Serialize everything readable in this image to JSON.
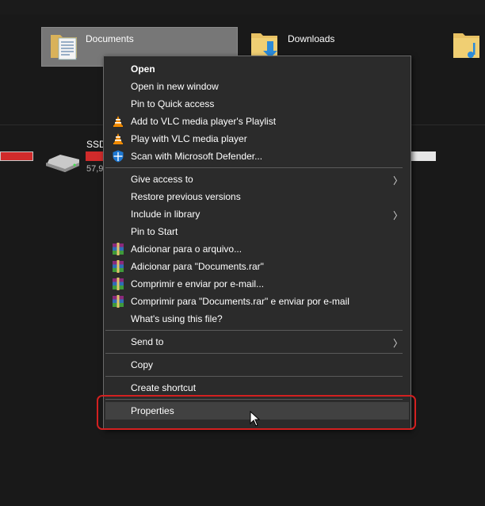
{
  "folders": {
    "documents_label": "Documents",
    "downloads_label": "Downloads"
  },
  "drive": {
    "label": "SSD",
    "size": "57,9"
  },
  "context_menu": {
    "items": [
      {
        "label": "Open",
        "bold": true,
        "icon": "",
        "submenu": false
      },
      {
        "label": "Open in new window",
        "icon": "",
        "submenu": false
      },
      {
        "label": "Pin to Quick access",
        "icon": "",
        "submenu": false
      },
      {
        "label": "Add to VLC media player's Playlist",
        "icon": "vlc-icon",
        "submenu": false
      },
      {
        "label": "Play with VLC media player",
        "icon": "vlc-icon",
        "submenu": false
      },
      {
        "label": "Scan with Microsoft Defender...",
        "icon": "defender-icon",
        "submenu": false
      },
      {
        "label": "Give access to",
        "icon": "",
        "submenu": true
      },
      {
        "label": "Restore previous versions",
        "icon": "",
        "submenu": false
      },
      {
        "label": "Include in library",
        "icon": "",
        "submenu": true
      },
      {
        "label": "Pin to Start",
        "icon": "",
        "submenu": false
      },
      {
        "label": "Adicionar para o arquivo...",
        "icon": "winrar-icon",
        "submenu": false
      },
      {
        "label": "Adicionar para \"Documents.rar\"",
        "icon": "winrar-icon",
        "submenu": false
      },
      {
        "label": "Comprimir e enviar por e-mail...",
        "icon": "winrar-icon",
        "submenu": false
      },
      {
        "label": "Comprimir para \"Documents.rar\" e enviar por e-mail",
        "icon": "winrar-icon",
        "submenu": false
      },
      {
        "label": "What's using this file?",
        "icon": "",
        "submenu": false
      },
      {
        "label": "Send to",
        "icon": "",
        "submenu": true
      },
      {
        "label": "Copy",
        "icon": "",
        "submenu": false
      },
      {
        "label": "Create shortcut",
        "icon": "",
        "submenu": false
      },
      {
        "label": "Properties",
        "icon": "",
        "submenu": false,
        "hovered": true
      }
    ],
    "submenu_arrow": "〉"
  },
  "colors": {
    "menu_bg": "#2b2b2b",
    "highlight": "#d32020",
    "hover": "#414141"
  }
}
